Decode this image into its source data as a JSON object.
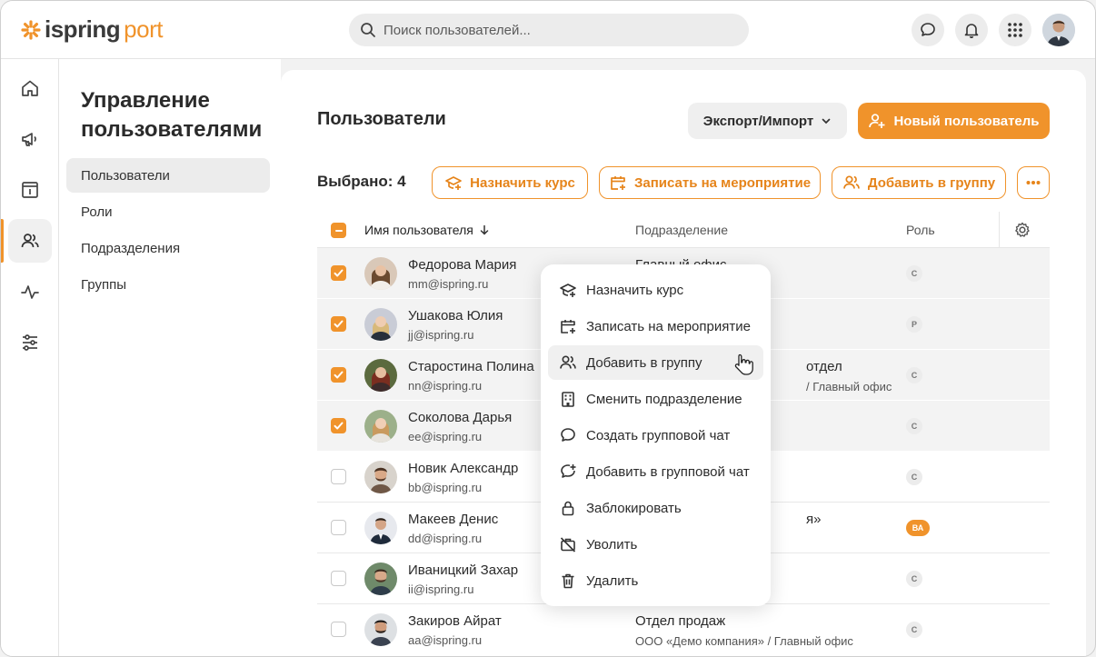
{
  "app": {
    "logo_part1": "ispring",
    "logo_part2": "port",
    "search_placeholder": "Поиск пользователей..."
  },
  "colors": {
    "accent": "#f0932b",
    "selected_row": "#f3f3f3"
  },
  "rail": [
    "home-icon",
    "megaphone-icon",
    "info-board-icon",
    "users-icon",
    "pulse-icon",
    "sliders-icon"
  ],
  "section": {
    "title": "Управление пользователями",
    "items": [
      {
        "label": "Пользователи",
        "active": true
      },
      {
        "label": "Роли",
        "active": false
      },
      {
        "label": "Подразделения",
        "active": false
      },
      {
        "label": "Группы",
        "active": false
      }
    ]
  },
  "main": {
    "title": "Пользователи",
    "export_label": "Экспорт/Импорт",
    "new_user_label": "Новый пользователь",
    "selected_label": "Выбрано: 4",
    "bulk": {
      "assign_course": "Назначить курс",
      "enroll_event": "Записать на мероприятие",
      "add_group": "Добавить в группу"
    }
  },
  "table": {
    "headers": {
      "name": "Имя пользователя",
      "dept": "Подразделение",
      "role": "Роль"
    },
    "rows": [
      {
        "name": "Федорова Мария",
        "email": "mm@ispring.ru",
        "dept": "Главный офис",
        "dept_path": "",
        "role": "С",
        "selected": true
      },
      {
        "name": "Ушакова Юлия",
        "email": "jj@ispring.ru",
        "dept": "",
        "dept_path": "",
        "role": "Р",
        "selected": true
      },
      {
        "name": "Старостина Полина",
        "email": "nn@ispring.ru",
        "dept": "отдел",
        "dept_path": "/ Главный офис",
        "role": "С",
        "selected": true
      },
      {
        "name": "Соколова Дарья",
        "email": "ee@ispring.ru",
        "dept": "",
        "dept_path": "",
        "role": "С",
        "selected": true
      },
      {
        "name": "Новик Александр",
        "email": "bb@ispring.ru",
        "dept": "",
        "dept_path": "",
        "role": "С",
        "selected": false
      },
      {
        "name": "Макеев Денис",
        "email": "dd@ispring.ru",
        "dept": "я»",
        "dept_path": "",
        "role": "ВА",
        "selected": false
      },
      {
        "name": "Иваницкий Захар",
        "email": "ii@ispring.ru",
        "dept": "",
        "dept_path": "",
        "role": "С",
        "selected": false
      },
      {
        "name": "Закиров Айрат",
        "email": "aa@ispring.ru",
        "dept": "Отдел продаж",
        "dept_path": "ООО «Демо компания» / Главный офис",
        "role": "С",
        "selected": false
      }
    ]
  },
  "context_menu": [
    {
      "label": "Назначить курс",
      "icon": "graduation-cap-icon"
    },
    {
      "label": "Записать на мероприятие",
      "icon": "calendar-plus-icon"
    },
    {
      "label": "Добавить в группу",
      "icon": "users-icon",
      "hover": true
    },
    {
      "label": "Сменить подразделение",
      "icon": "building-icon"
    },
    {
      "label": "Создать групповой чат",
      "icon": "chat-bubble-icon"
    },
    {
      "label": "Добавить в групповой чат",
      "icon": "chat-add-icon"
    },
    {
      "label": "Заблокировать",
      "icon": "lock-icon"
    },
    {
      "label": "Уволить",
      "icon": "briefcase-off-icon"
    },
    {
      "label": "Удалить",
      "icon": "trash-icon"
    }
  ]
}
